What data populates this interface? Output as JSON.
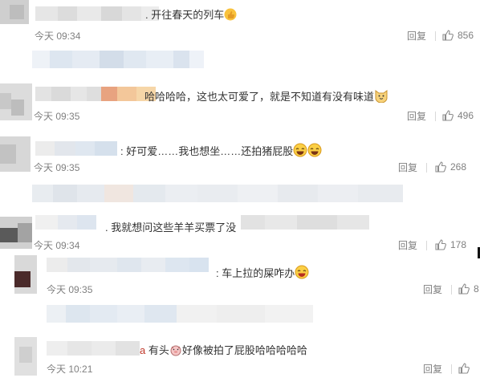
{
  "comments": [
    {
      "text": "开往春天的列车",
      "time": "今天 09:34",
      "reply": "回复",
      "likes": "856"
    },
    {
      "text": "哈哈哈哈，这也太可爱了，就是不知道有没有味道",
      "time": "今天 09:35",
      "reply": "回复",
      "likes": "496"
    },
    {
      "text": "好可爱……我也想坐……还拍猪屁股",
      "time": "今天 09:35",
      "reply": "回复",
      "likes": "268"
    },
    {
      "text": "我就想问这些羊羊买票了没",
      "time": "今天 09:34",
      "reply": "回复",
      "likes": "178"
    },
    {
      "text": "车上拉的屎咋办",
      "time": "今天 09:35",
      "reply": "回复",
      "likes": "8"
    },
    {
      "text": "有头",
      "text2": "好像被拍了屁股哈哈哈哈哈",
      "time": "今天 10:21",
      "reply": "回复",
      "likes": ""
    }
  ],
  "colors": {
    "text": "#333333",
    "meta": "#808080",
    "accent": "#e8a33a"
  },
  "icons": [
    "thumbs-up-icon",
    "laugh-emoji-icon",
    "cat-emoji-icon",
    "pig-emoji-icon"
  ]
}
